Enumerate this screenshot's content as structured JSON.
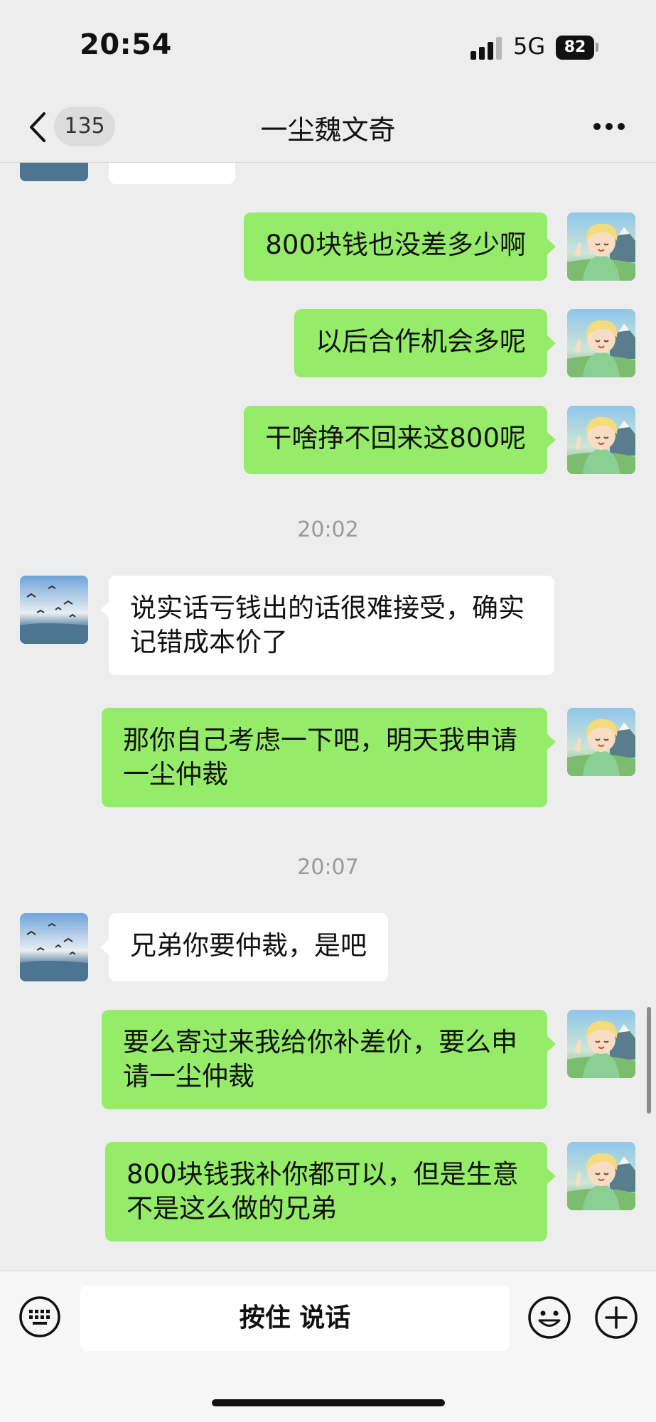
{
  "status": {
    "time": "20:54",
    "network": "5G",
    "battery": "82"
  },
  "nav": {
    "back_count": "135",
    "title": "一尘魏文奇"
  },
  "messages": [
    {
      "type": "out",
      "text": "800块钱也没差多少啊"
    },
    {
      "type": "out",
      "text": "以后合作机会多呢"
    },
    {
      "type": "out",
      "text": "干啥挣不回来这800呢"
    },
    {
      "type": "time",
      "text": "20:02"
    },
    {
      "type": "in",
      "text": "说实话亏钱出的话很难接受，确实记错成本价了"
    },
    {
      "type": "out",
      "text": "那你自己考虑一下吧，明天我申请一尘仲裁"
    },
    {
      "type": "time",
      "text": "20:07"
    },
    {
      "type": "in",
      "text": "兄弟你要仲裁，是吧"
    },
    {
      "type": "out",
      "text": "要么寄过来我给你补差价，要么申请一尘仲裁"
    },
    {
      "type": "out",
      "text": "800块钱我补你都可以，但是生意不是这么做的兄弟"
    }
  ],
  "input": {
    "talk_label": "按住 说话"
  },
  "icons": {
    "back": "chevron-left-icon",
    "more": "more-dots-icon",
    "keyboard": "keyboard-icon",
    "emoji": "emoji-icon",
    "plus": "plus-circle-icon"
  },
  "colors": {
    "outgoing_bubble": "#95ec69",
    "incoming_bubble": "#ffffff",
    "background": "#ededed"
  }
}
